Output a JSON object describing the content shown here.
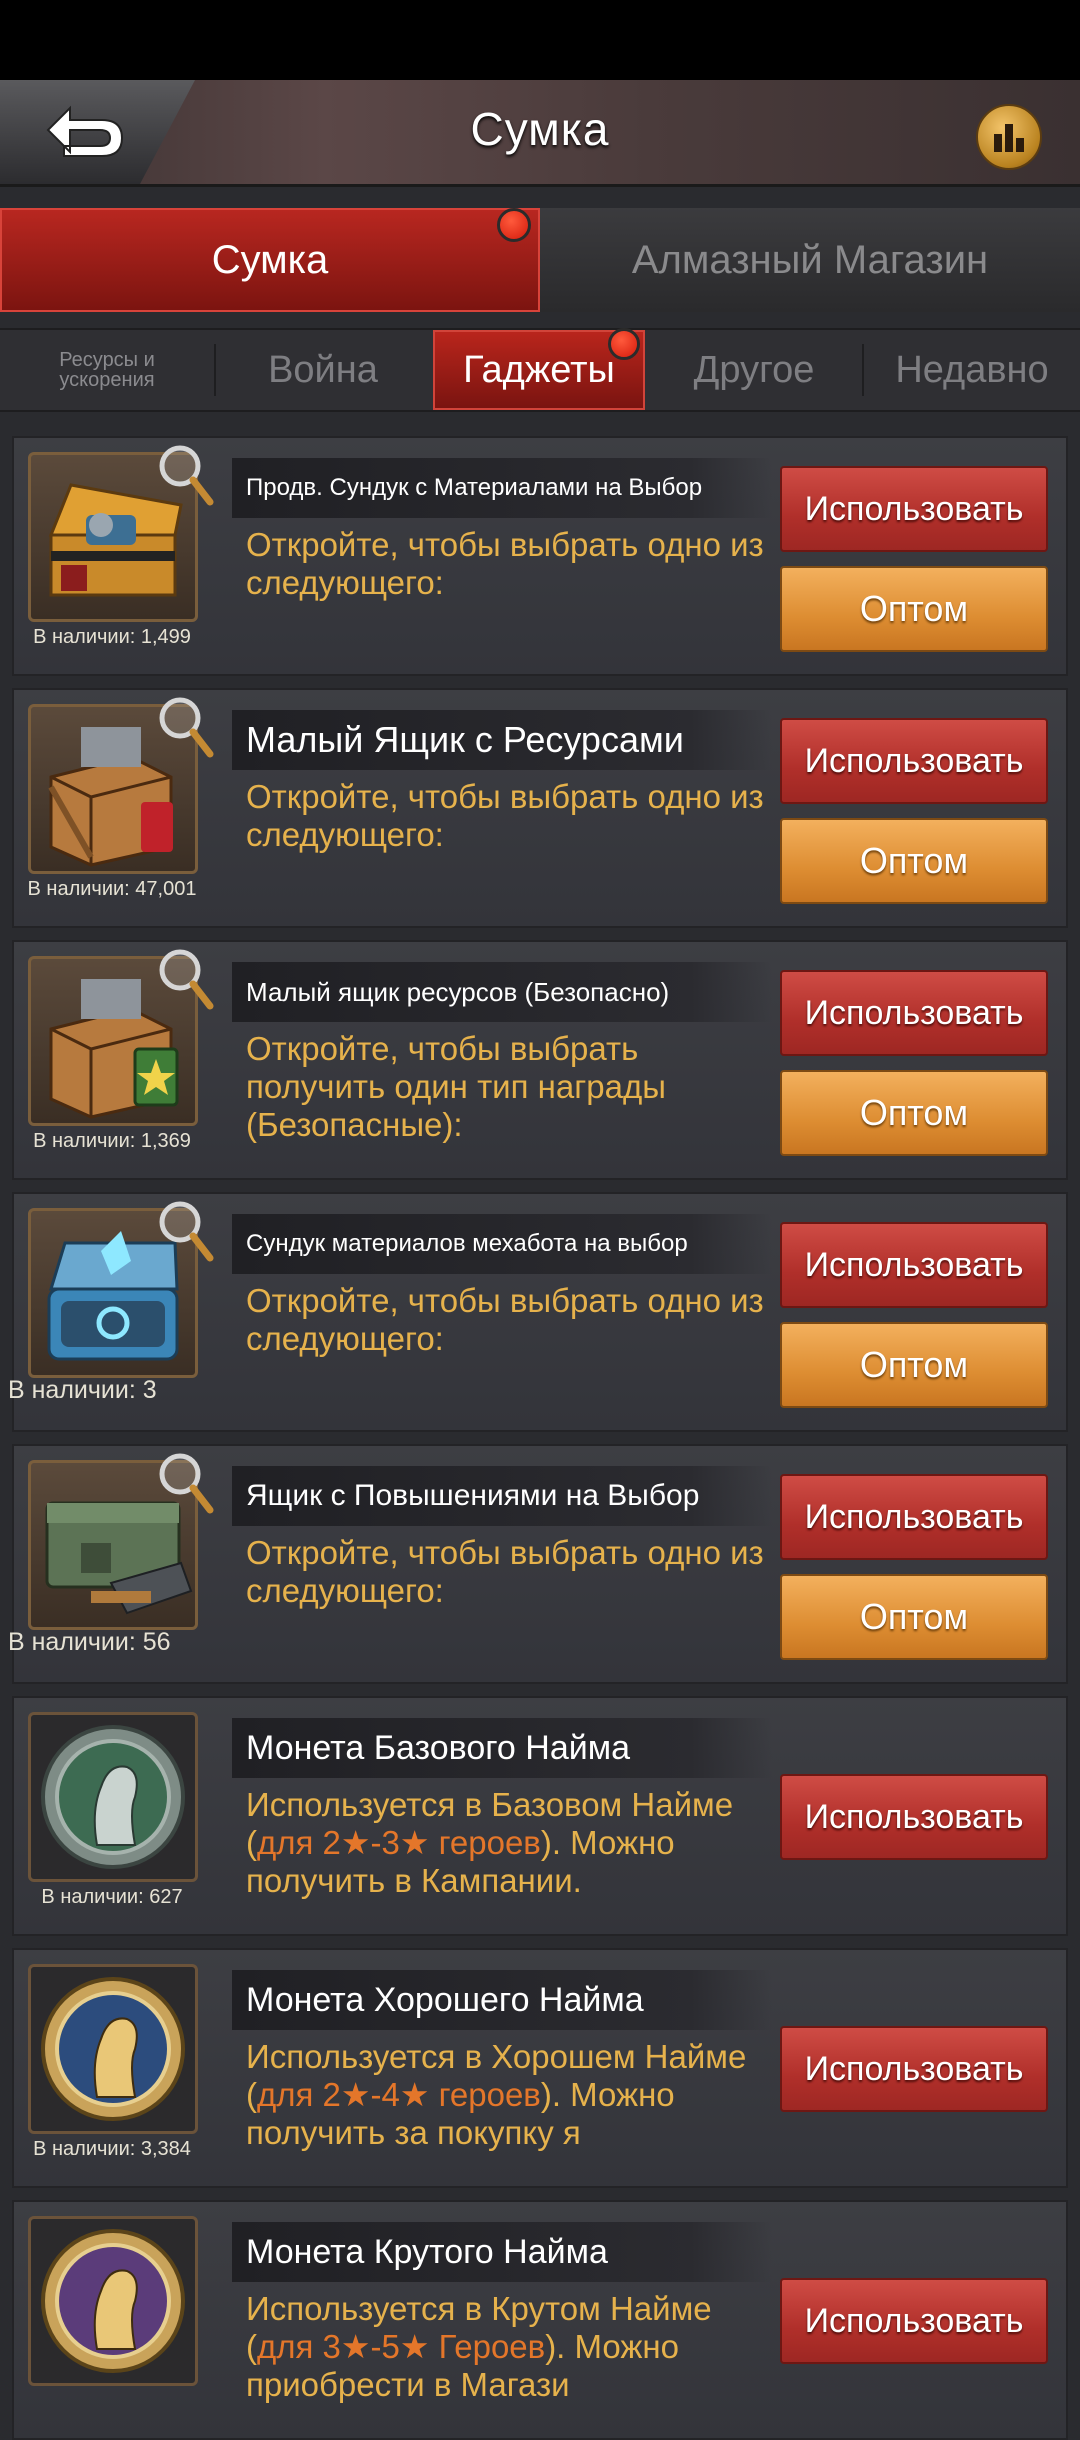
{
  "header": {
    "title": "Сумка"
  },
  "main_tabs": [
    {
      "label": "Сумка",
      "active": true
    },
    {
      "label": "Алмазный Магазин",
      "active": false
    }
  ],
  "sub_tabs": [
    {
      "label": "Ресурсы и ускорения"
    },
    {
      "label": "Война"
    },
    {
      "label": "Гаджеты",
      "active": true
    },
    {
      "label": "Другое"
    },
    {
      "label": "Недавно"
    }
  ],
  "items": [
    {
      "name": "Продв. Сундук с Материалами на Выбор",
      "desc": "Откройте, чтобы выбрать одно из следующего:",
      "stock": "В наличии: 1,499",
      "use_label": "Использовать",
      "bulk_label": "Оптом"
    },
    {
      "name": "Малый Ящик с Ресурсами",
      "desc": "Откройте, чтобы выбрать одно из следующего:",
      "stock": "В наличии: 47,001",
      "use_label": "Использовать",
      "bulk_label": "Оптом"
    },
    {
      "name": "Малый ящик ресурсов (Безопасно)",
      "desc": "Откройте, чтобы выбрать получить один тип награды (Безопасные):",
      "stock": "В наличии: 1,369",
      "use_label": "Использовать",
      "bulk_label": "Оптом"
    },
    {
      "name": "Сундук материалов мехабота на выбор",
      "desc": "Откройте, чтобы выбрать одно из следующего:",
      "stock": "В наличии: 3",
      "use_label": "Использовать",
      "bulk_label": "Оптом"
    },
    {
      "name": "Ящик с Повышениями на Выбор",
      "desc": "Откройте, чтобы выбрать одно из следующего:",
      "stock": "В наличии: 56",
      "use_label": "Использовать",
      "bulk_label": "Оптом"
    },
    {
      "name": "Монета Базового Найма",
      "desc_a": "Используется в Базовом Найме (",
      "desc_hl": "для 2★-3★ героев",
      "desc_b": "). Можно получить в Кампании.",
      "stock": "В наличии: 627",
      "use_label": "Использовать"
    },
    {
      "name": "Монета Хорошего Найма",
      "desc_a": "Используется в Хорошем Найме (",
      "desc_hl": "для 2★-4★ героев",
      "desc_b": "). Можно получить за покупку я",
      "stock": "В наличии: 3,384",
      "use_label": "Использовать"
    },
    {
      "name": "Монета Крутого Найма",
      "desc_a": "Используется в Крутом Найме (",
      "desc_hl": "для 3★-5★ Героев",
      "desc_b": "). Можно приобрести в Магази",
      "use_label": "Использовать"
    }
  ],
  "colors": {
    "accent_red": "#b82720",
    "button_orange": "#dd8d32",
    "desc_gold": "#e6b24c",
    "highlight_orange": "#e4762a"
  }
}
